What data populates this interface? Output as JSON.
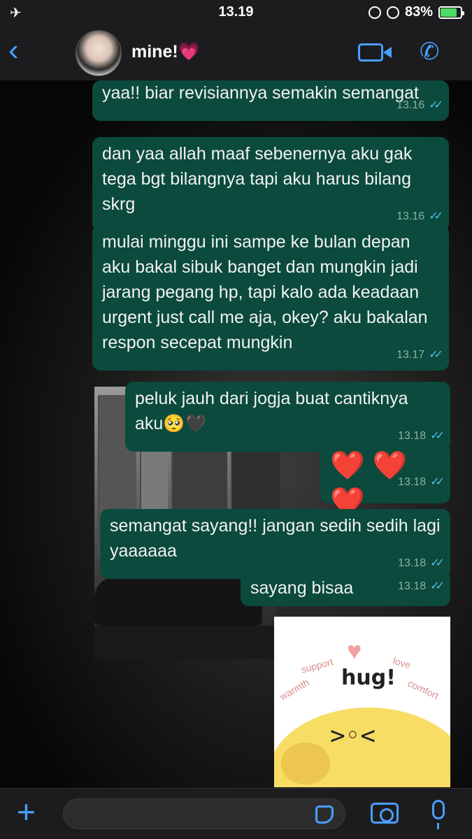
{
  "status_bar": {
    "time": "13.19",
    "battery": "83%",
    "battery_level": 0.83
  },
  "header": {
    "contact_name": "mine!💗"
  },
  "messages": [
    {
      "text": "yaa!! biar revisiannya semakin semangat",
      "time": "13.16"
    },
    {
      "text": "dan yaa allah maaf sebenernya aku gak tega bgt bilangnya tapi aku harus bilang skrg",
      "time": "13.16"
    },
    {
      "text": "mulai minggu ini sampe ke bulan depan aku bakal sibuk banget dan mungkin jadi jarang pegang hp, tapi kalo ada keadaan urgent just call me aja, okey? aku bakalan respon secepat mungkin",
      "time": "13.17"
    },
    {
      "text": "peluk jauh dari jogja buat cantiknya aku🥺🖤",
      "time": "13.18"
    },
    {
      "text": "❤️ ❤️ ❤️",
      "time": "13.18"
    },
    {
      "text": "semangat sayang!! jangan sedih sedih lagi yaaaaaa",
      "time": "13.18"
    },
    {
      "text": "sayang bisaa",
      "time": "13.18"
    }
  ],
  "sticker": {
    "main_text": "hug!",
    "words": [
      "support",
      "love",
      "warmth",
      "comfort"
    ]
  },
  "colors": {
    "bubble": "#0b4a3d",
    "accent": "#4a9eff",
    "read_ticks": "#53bdeb"
  },
  "icons": {
    "airplane": "airplane-icon",
    "back": "chevron-left-icon",
    "video": "video-call-icon",
    "phone": "phone-icon",
    "plus": "plus-icon",
    "sticker": "sticker-icon",
    "camera": "camera-icon",
    "mic": "microphone-icon"
  }
}
